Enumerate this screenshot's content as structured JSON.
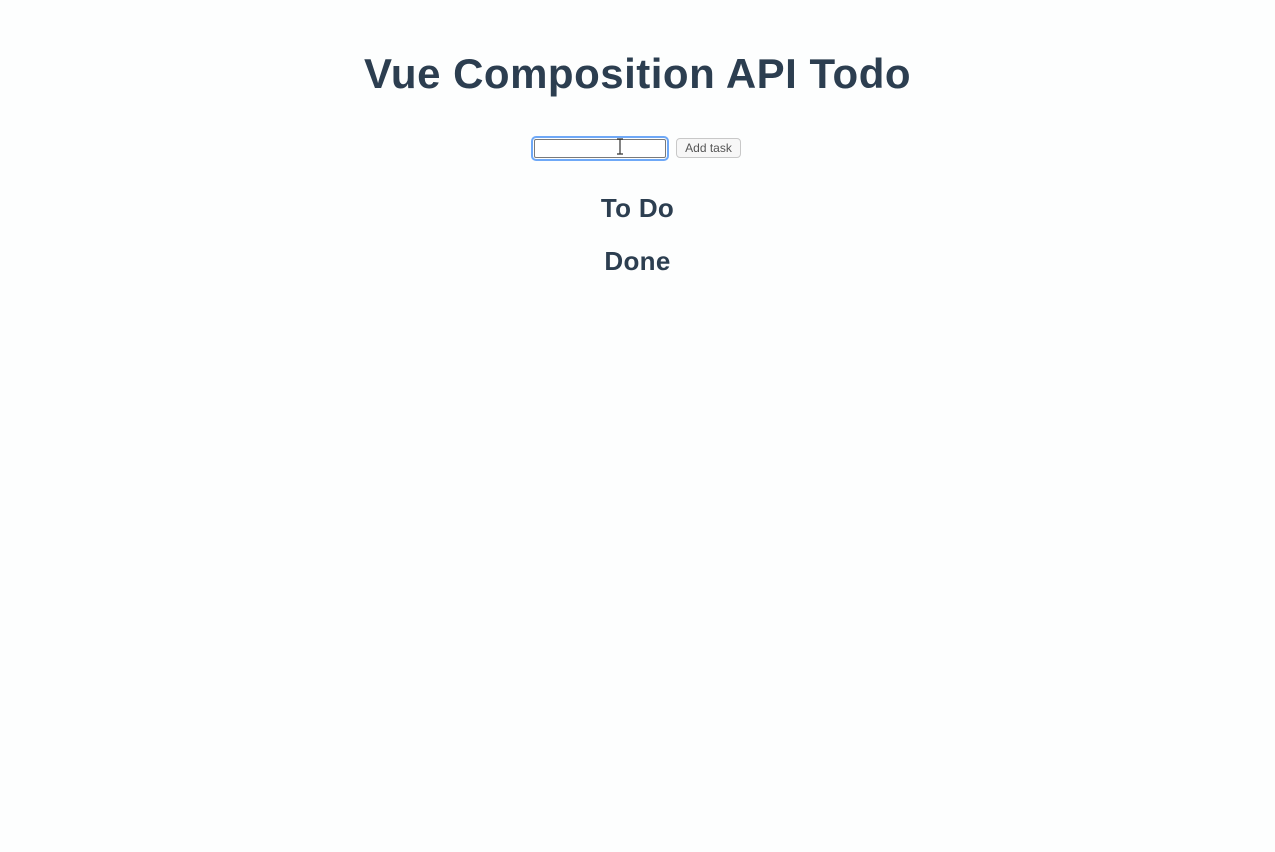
{
  "header": {
    "title": "Vue Composition API Todo"
  },
  "form": {
    "input_value": "",
    "button_label": "Add task"
  },
  "sections": {
    "todo_heading": "To Do",
    "done_heading": "Done"
  }
}
